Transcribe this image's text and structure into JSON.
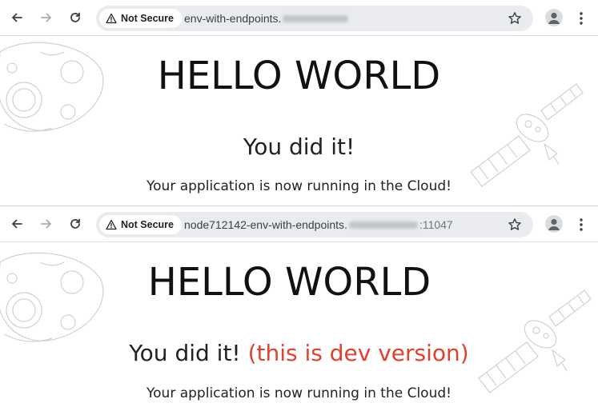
{
  "windows": [
    {
      "security_chip": "Not Secure",
      "url_prefix": "env-with-endpoints.",
      "url_suffix": "",
      "heading": "HELLO WORLD",
      "subheading": "You did it!",
      "dev_note": "",
      "tagline": "Your application is now running in the Cloud!"
    },
    {
      "security_chip": "Not Secure",
      "url_prefix": "node712142-env-with-endpoints.",
      "url_suffix": ":11047",
      "heading": "HELLO WORLD",
      "subheading": "You did it!",
      "dev_note": "(this is dev version)",
      "tagline": "Your application is now running in the Cloud!"
    }
  ],
  "colors": {
    "dev_note": "#e0422c",
    "omnibox": "#e9ebef",
    "toolbar_icons": "#5f6368"
  },
  "icons": [
    "back-arrow-icon",
    "forward-arrow-icon",
    "reload-icon",
    "warning-triangle-icon",
    "star-icon",
    "profile-icon",
    "more-menu-icon",
    "moon-illustration",
    "satellite-illustration"
  ]
}
